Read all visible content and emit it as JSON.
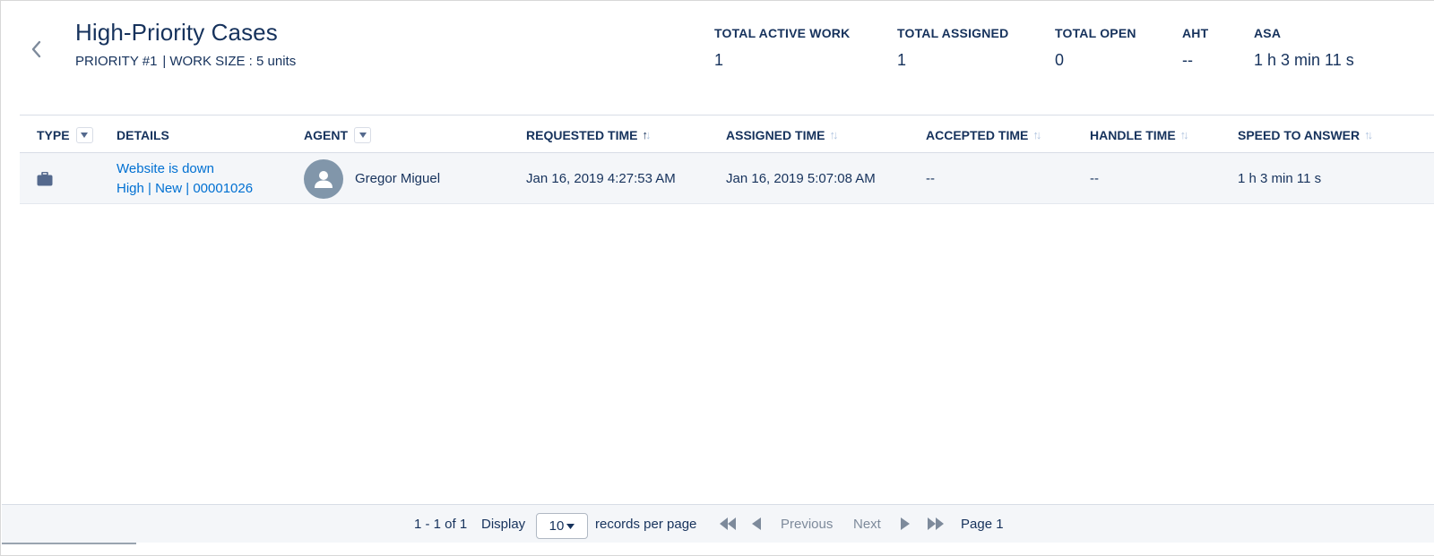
{
  "header": {
    "title": "High-Priority Cases",
    "priority": "PRIORITY #1",
    "separator": "|",
    "work_size": "WORK SIZE : 5 units"
  },
  "stats": [
    {
      "label": "TOTAL ACTIVE WORK",
      "value": "1"
    },
    {
      "label": "TOTAL ASSIGNED",
      "value": "1"
    },
    {
      "label": "TOTAL OPEN",
      "value": "0"
    },
    {
      "label": "AHT",
      "value": "--"
    },
    {
      "label": "ASA",
      "value": "1 h 3 min 11 s"
    }
  ],
  "table": {
    "columns": [
      {
        "label": "TYPE",
        "control": "filter"
      },
      {
        "label": "DETAILS",
        "control": "none"
      },
      {
        "label": "AGENT",
        "control": "filter"
      },
      {
        "label": "REQUESTED TIME",
        "control": "sort-active"
      },
      {
        "label": "ASSIGNED TIME",
        "control": "sort"
      },
      {
        "label": "ACCEPTED TIME",
        "control": "sort"
      },
      {
        "label": "HANDLE TIME",
        "control": "sort"
      },
      {
        "label": "SPEED TO ANSWER",
        "control": "sort"
      }
    ],
    "rows": [
      {
        "type_icon": "briefcase-icon",
        "details_title": "Website is down",
        "details_meta": "High | New | 00001026",
        "agent": "Gregor Miguel",
        "agent_icon": "user-avatar-icon",
        "requested_time": "Jan 16, 2019 4:27:53 AM",
        "assigned_time": "Jan 16, 2019 5:07:08 AM",
        "accepted_time": "--",
        "handle_time": "--",
        "speed_to_answer": "1 h 3 min 11 s"
      }
    ]
  },
  "pagination": {
    "range": "1 - 1 of 1",
    "display_label": "Display",
    "page_size": "10",
    "per_page_label": "records per page",
    "previous_label": "Previous",
    "next_label": "Next",
    "page_label": "Page 1"
  },
  "colors": {
    "text": "#16325c",
    "link": "#0070d2",
    "row_bg": "#f4f6f9",
    "muted": "#7d8a9b",
    "icon": "#54698d"
  }
}
